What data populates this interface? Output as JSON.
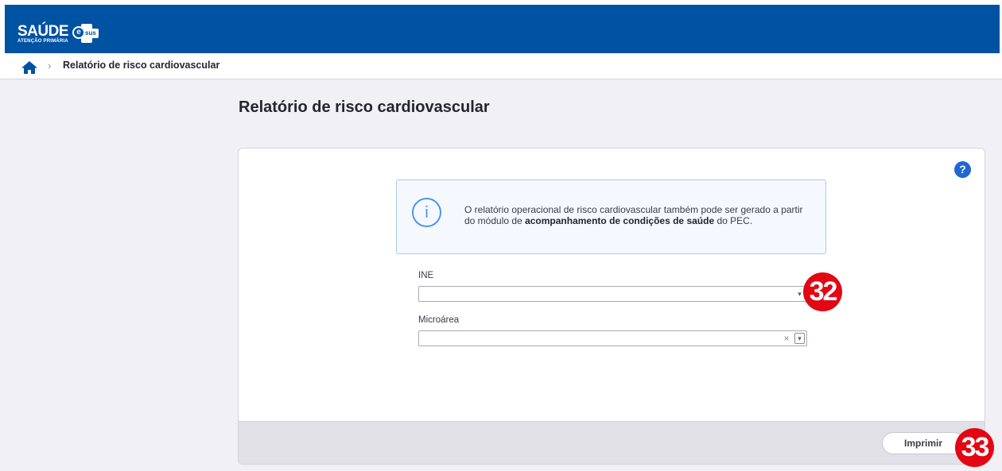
{
  "header": {
    "logo_text": "SAÚDE",
    "logo_sub": "ATENÇÃO PRIMÁRIA",
    "logo_e": "e",
    "logo_sus": "sus"
  },
  "breadcrumb": {
    "separator": "›",
    "current": "Relatório de risco cardiovascular"
  },
  "page": {
    "title": "Relatório de risco cardiovascular"
  },
  "help": {
    "label": "?"
  },
  "info": {
    "icon_glyph": "i",
    "text_before": "O relatório operacional de risco cardiovascular também pode ser gerado a partir do módulo de ",
    "text_bold": "acompanhamento de condições de saúde",
    "text_after": " do PEC."
  },
  "form": {
    "ine_label": "INE",
    "ine_value": "",
    "microarea_label": "Microárea",
    "microarea_value": "",
    "clear_glyph": "×",
    "arrow_glyph": "▾"
  },
  "footer": {
    "print_label": "Imprimir"
  },
  "markers": {
    "m1": "32",
    "m2": "33"
  },
  "colors": {
    "header_blue": "#0052a3",
    "accent_blue": "#1f67d3",
    "marker_red": "#e30613"
  }
}
